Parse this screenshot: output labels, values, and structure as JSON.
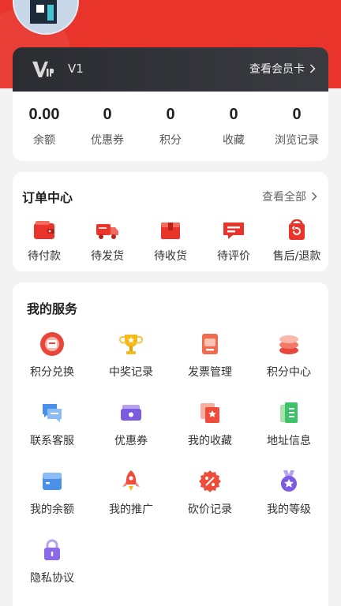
{
  "vip": {
    "level": "V1",
    "card_link": "查看会员卡"
  },
  "stats": [
    {
      "value": "0.00",
      "label": "余额"
    },
    {
      "value": "0",
      "label": "优惠券"
    },
    {
      "value": "0",
      "label": "积分"
    },
    {
      "value": "0",
      "label": "收藏"
    },
    {
      "value": "0",
      "label": "浏览记录"
    }
  ],
  "orders": {
    "title": "订单中心",
    "view_all": "查看全部",
    "items": [
      {
        "label": "待付款",
        "icon": "wallet-icon"
      },
      {
        "label": "待发货",
        "icon": "truck-icon"
      },
      {
        "label": "待收货",
        "icon": "package-icon"
      },
      {
        "label": "待评价",
        "icon": "comment-icon"
      },
      {
        "label": "售后/退款",
        "icon": "refund-icon"
      }
    ]
  },
  "services": {
    "title": "我的服务",
    "items": [
      {
        "label": "积分兑换",
        "icon": "points-exchange-icon"
      },
      {
        "label": "中奖记录",
        "icon": "trophy-icon"
      },
      {
        "label": "发票管理",
        "icon": "invoice-icon"
      },
      {
        "label": "积分中心",
        "icon": "coin-stack-icon"
      },
      {
        "label": "联系客服",
        "icon": "chat-icon"
      },
      {
        "label": "优惠券",
        "icon": "coupon-icon"
      },
      {
        "label": "我的收藏",
        "icon": "favorites-icon"
      },
      {
        "label": "地址信息",
        "icon": "address-book-icon"
      },
      {
        "label": "我的余额",
        "icon": "balance-card-icon"
      },
      {
        "label": "我的推广",
        "icon": "rocket-icon"
      },
      {
        "label": "砍价记录",
        "icon": "discount-icon"
      },
      {
        "label": "我的等级",
        "icon": "medal-icon"
      },
      {
        "label": "隐私协议",
        "icon": "lock-icon"
      }
    ]
  },
  "colors": {
    "brand_red": "#e8342a",
    "vip_dark": "#2b2c31"
  }
}
